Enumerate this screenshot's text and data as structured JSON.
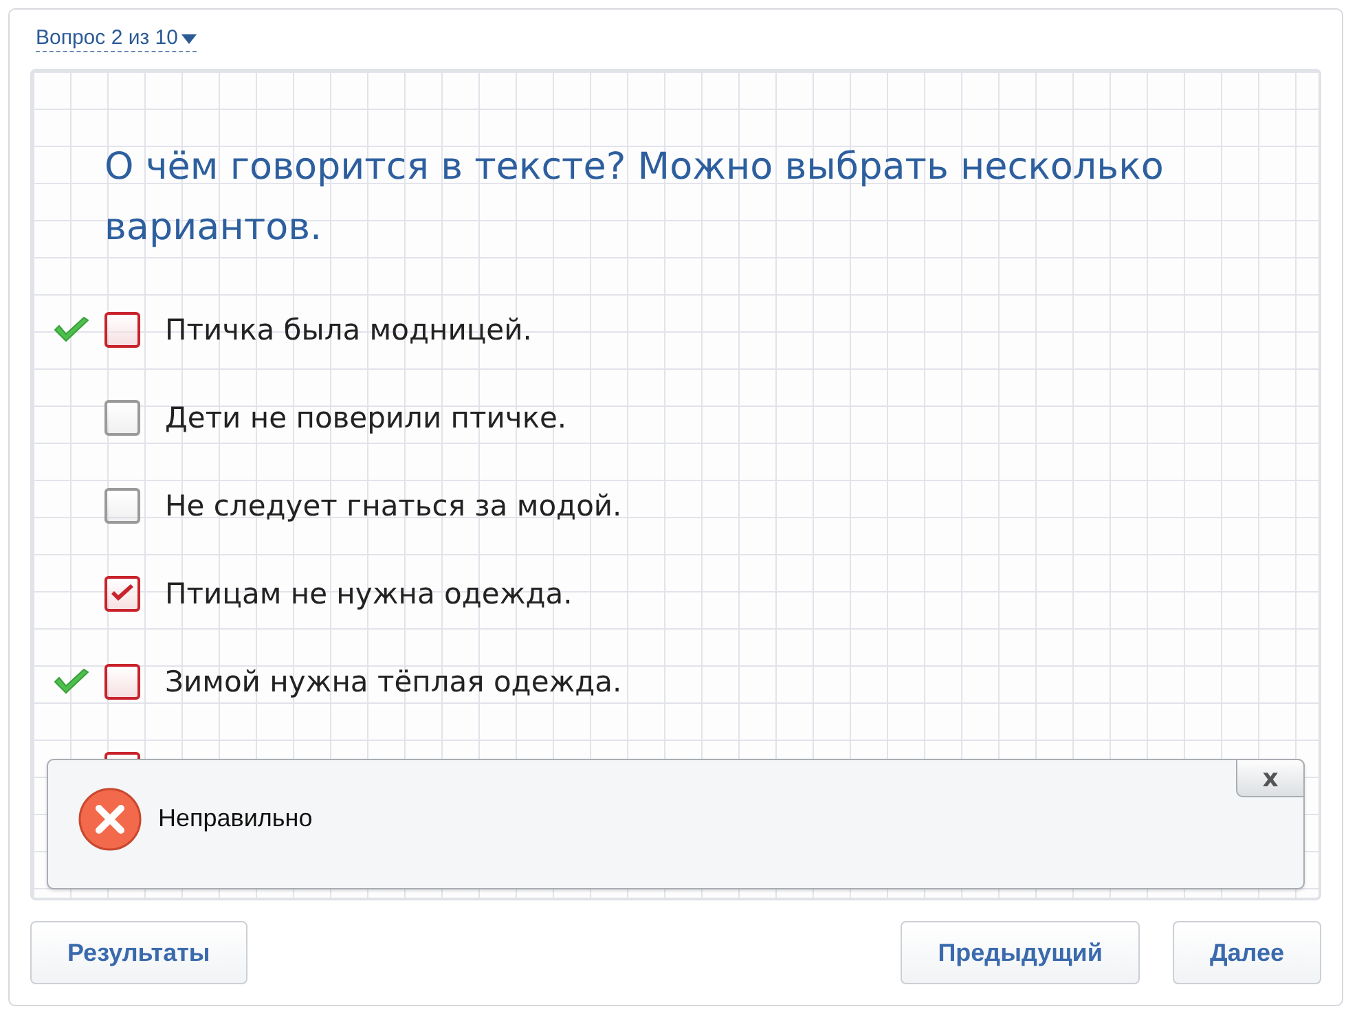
{
  "question_nav": {
    "label": "Вопрос 2 из 10"
  },
  "question": {
    "text": "О чём говорится в тексте? Можно выбрать несколько вариантов."
  },
  "options": [
    {
      "label": "Птичка была модницей.",
      "checked": false,
      "color": "#c8232c",
      "correct": true
    },
    {
      "label": "Дети не поверили птичке.",
      "checked": false,
      "color": "#9a9a9a",
      "correct": false
    },
    {
      "label": "Не следует гнаться за модой.",
      "checked": false,
      "color": "#9a9a9a",
      "correct": false
    },
    {
      "label": "Птицам не нужна одежда.",
      "checked": true,
      "color": "#c8232c",
      "correct": false
    },
    {
      "label": "Зимой нужна тёплая одежда.",
      "checked": false,
      "color": "#c8232c",
      "correct": true
    },
    {
      "color": "#c8232c"
    }
  ],
  "feedback": {
    "kind": "error",
    "text": "Неправильно",
    "close_label": "x"
  },
  "buttons": [
    {
      "label": "Результаты"
    },
    {
      "label": "Предыдущий"
    },
    {
      "label": "Далее"
    }
  ]
}
